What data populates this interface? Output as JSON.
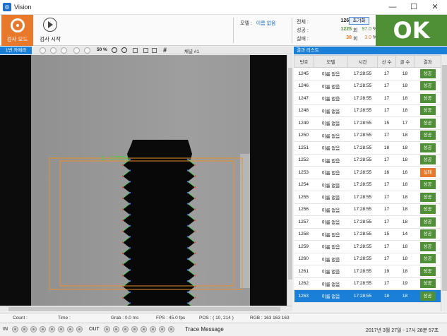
{
  "window": {
    "title": "Vision",
    "minimize": "—",
    "maximize": "☐",
    "close": "✕"
  },
  "toolbar": {
    "mode_label": "검사 모드",
    "start_label": "검사 시작",
    "model_label": "모델 :",
    "model_value": "이름 없음"
  },
  "stats": {
    "total_label": "전체 :",
    "total_value": "1263",
    "total_unit": "회",
    "pass_label": "성공 :",
    "pass_value": "1225",
    "pass_unit": "회",
    "pass_pct": "97.0",
    "pass_pct_unit": "%",
    "fail_label": "실패 :",
    "fail_value": "38",
    "fail_unit": "회",
    "fail_pct": "3.0",
    "fail_pct_unit": "%",
    "reset_label": "초기화"
  },
  "result_display": {
    "text": "OK",
    "color": "#4f8f35"
  },
  "camera": {
    "tab": "1번 카메라",
    "zoom": "50 %",
    "channel": "채널 #1",
    "overlay_label": "1 - 17779"
  },
  "results": {
    "header": "결과 리스트",
    "columns": [
      "번호",
      "모델",
      "시간",
      "산 수",
      "골 수",
      "결과"
    ],
    "rows": [
      {
        "no": "1245",
        "model": "이름 없음",
        "time": "17:28:55",
        "peaks": "17",
        "valleys": "18",
        "result": "성공"
      },
      {
        "no": "1246",
        "model": "이름 없음",
        "time": "17:28:55",
        "peaks": "17",
        "valleys": "18",
        "result": "성공"
      },
      {
        "no": "1247",
        "model": "이름 없음",
        "time": "17:28:55",
        "peaks": "17",
        "valleys": "18",
        "result": "성공"
      },
      {
        "no": "1248",
        "model": "이름 없음",
        "time": "17:28:55",
        "peaks": "17",
        "valleys": "18",
        "result": "성공"
      },
      {
        "no": "1249",
        "model": "이름 없음",
        "time": "17:28:55",
        "peaks": "15",
        "valleys": "17",
        "result": "성공"
      },
      {
        "no": "1250",
        "model": "이름 없음",
        "time": "17:28:55",
        "peaks": "17",
        "valleys": "18",
        "result": "성공"
      },
      {
        "no": "1251",
        "model": "이름 없음",
        "time": "17:28:55",
        "peaks": "18",
        "valleys": "18",
        "result": "성공"
      },
      {
        "no": "1252",
        "model": "이름 없음",
        "time": "17:28:55",
        "peaks": "17",
        "valleys": "18",
        "result": "성공"
      },
      {
        "no": "1253",
        "model": "이름 없음",
        "time": "17:28:55",
        "peaks": "16",
        "valleys": "16",
        "result": "실패"
      },
      {
        "no": "1254",
        "model": "이름 없음",
        "time": "17:28:55",
        "peaks": "17",
        "valleys": "18",
        "result": "성공"
      },
      {
        "no": "1255",
        "model": "이름 없음",
        "time": "17:28:55",
        "peaks": "17",
        "valleys": "18",
        "result": "성공"
      },
      {
        "no": "1256",
        "model": "이름 없음",
        "time": "17:28:55",
        "peaks": "17",
        "valleys": "18",
        "result": "성공"
      },
      {
        "no": "1257",
        "model": "이름 없음",
        "time": "17:28:55",
        "peaks": "17",
        "valleys": "18",
        "result": "성공"
      },
      {
        "no": "1258",
        "model": "이름 없음",
        "time": "17:28:55",
        "peaks": "15",
        "valleys": "14",
        "result": "성공"
      },
      {
        "no": "1259",
        "model": "이름 없음",
        "time": "17:28:55",
        "peaks": "17",
        "valleys": "18",
        "result": "성공"
      },
      {
        "no": "1260",
        "model": "이름 없음",
        "time": "17:28:55",
        "peaks": "17",
        "valleys": "18",
        "result": "성공"
      },
      {
        "no": "1261",
        "model": "이름 없음",
        "time": "17:28:55",
        "peaks": "19",
        "valleys": "18",
        "result": "성공"
      },
      {
        "no": "1262",
        "model": "이름 없음",
        "time": "17:28:55",
        "peaks": "17",
        "valleys": "19",
        "result": "성공"
      },
      {
        "no": "1263",
        "model": "이름 없음",
        "time": "17:28:55",
        "peaks": "18",
        "valleys": "18",
        "result": "성공"
      }
    ],
    "selected_no": "1263",
    "pass_color": "#4f8f35",
    "fail_color": "#e8782a"
  },
  "status": {
    "count_label": "Count :",
    "time_label": "Time :",
    "grab": "Grab :  0.0 ms",
    "fps": "FPS :  45.0 fps",
    "pos": "POS :  (   10,  214 )",
    "rgb": "RGB :  163 163 163"
  },
  "io": {
    "in_label": "IN",
    "out_label": "OUT",
    "trace_label": "Trace Message",
    "datetime": "2017년  3월 27일 - 17시 28분 57초"
  },
  "accent_color": "#1a7fd6",
  "mode_color": "#e8782a"
}
